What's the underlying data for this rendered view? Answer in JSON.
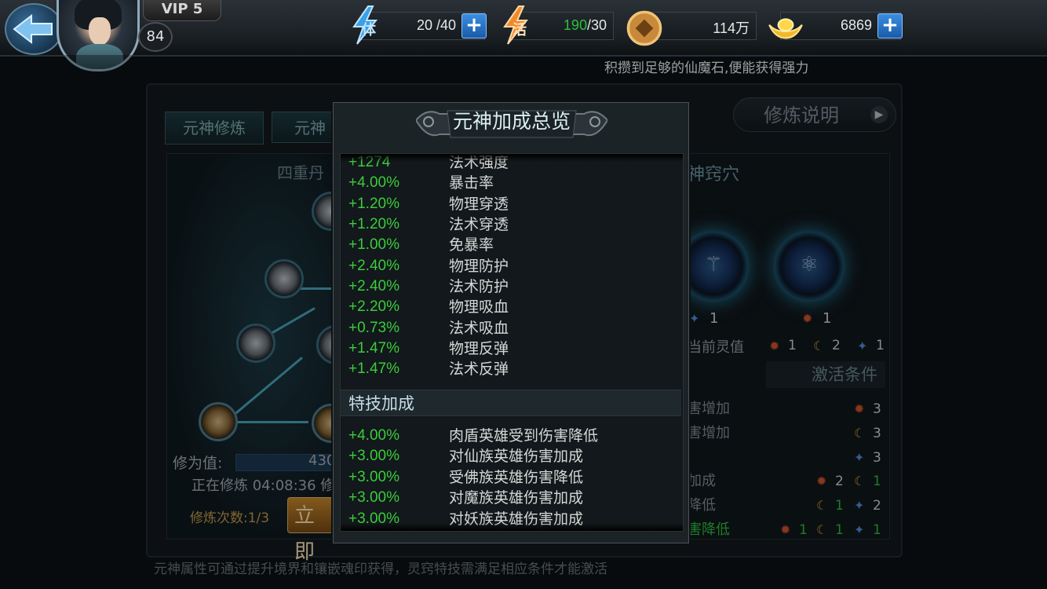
{
  "topbar": {
    "vip_label": "VIP 5",
    "level": "84",
    "stamina": {
      "icon_char": "体",
      "value": "20 /40"
    },
    "vitality": {
      "icon_char": "活",
      "value_current": "190",
      "value_rest": "/30"
    },
    "coins": {
      "value": "114万"
    },
    "ingots": {
      "value": "6869"
    },
    "plus_symbol": "+",
    "tip": "积攒到足够的仙魔石,便能获得强力"
  },
  "background": {
    "tabs": [
      "元神修炼",
      "元神"
    ],
    "explain_button": "修炼说明",
    "left_section_title": "四重丹",
    "cultivation_label": "修为值:",
    "cultivation_value": "430",
    "cultivation_status": "正在修炼 04:08:36 修",
    "cultivation_count": "修炼次数:1/3",
    "instant_button": "立即",
    "right_section_title": "神窍穴",
    "orbs": [
      {
        "glyph": "⚚",
        "count": "1",
        "icon": "star-icon"
      },
      {
        "glyph": "⚛",
        "count": "1",
        "icon": "fire-icon"
      }
    ],
    "current_spirit_label": "当前灵值",
    "spirit_values": [
      "1",
      "2",
      "1"
    ],
    "activate_title": "激活条件",
    "conditions": [
      {
        "text": "害增加",
        "nums": [
          "3"
        ],
        "icons": [
          "fire-icon"
        ],
        "green": false
      },
      {
        "text": "害增加",
        "nums": [
          "3"
        ],
        "icons": [
          "moon-icon"
        ],
        "green": false
      },
      {
        "text": "",
        "nums": [
          "3"
        ],
        "icons": [
          "star-icon"
        ],
        "green": false
      },
      {
        "text": "加成",
        "nums": [
          "2",
          "1"
        ],
        "icons": [
          "fire-icon",
          "moon-icon"
        ],
        "green": false
      },
      {
        "text": "降低",
        "nums": [
          "1",
          "2"
        ],
        "icons": [
          "moon-icon",
          "star-icon"
        ],
        "green": false
      },
      {
        "text": "害降低",
        "nums": [
          "1",
          "1",
          "1"
        ],
        "icons": [
          "fire-icon",
          "moon-icon",
          "star-icon"
        ],
        "green": true
      }
    ],
    "footer_tip": "元神属性可通过提升境界和镶嵌魂印获得，灵窍特技需满足相应条件才能激活"
  },
  "popup": {
    "title": "元神加成总览",
    "stats": [
      {
        "value": "+1274",
        "name": "法术强度"
      },
      {
        "value": "+4.00%",
        "name": "暴击率"
      },
      {
        "value": "+1.20%",
        "name": "物理穿透"
      },
      {
        "value": "+1.20%",
        "name": "法术穿透"
      },
      {
        "value": "+1.00%",
        "name": "免暴率"
      },
      {
        "value": "+2.40%",
        "name": "物理防护"
      },
      {
        "value": "+2.40%",
        "name": "法术防护"
      },
      {
        "value": "+2.20%",
        "name": "物理吸血"
      },
      {
        "value": "+0.73%",
        "name": "法术吸血"
      },
      {
        "value": "+1.47%",
        "name": "物理反弹"
      },
      {
        "value": "+1.47%",
        "name": "法术反弹"
      }
    ],
    "skill_section_title": "特技加成",
    "skill_stats": [
      {
        "value": "+4.00%",
        "name": "肉盾英雄受到伤害降低"
      },
      {
        "value": "+3.00%",
        "name": "对仙族英雄伤害加成"
      },
      {
        "value": "+3.00%",
        "name": "受佛族英雄伤害降低"
      },
      {
        "value": "+3.00%",
        "name": "对魔族英雄伤害加成"
      },
      {
        "value": "+3.00%",
        "name": "对妖族英雄伤害加成"
      }
    ]
  },
  "colors": {
    "stat_green": "#3ccb3c",
    "accent_blue": "#2f7fd6",
    "vitality_green": "#2fbf3e"
  }
}
